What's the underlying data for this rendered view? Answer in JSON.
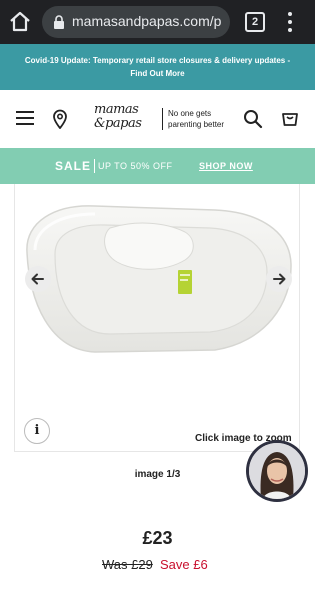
{
  "browser": {
    "url": "mamasandpapas.com/p",
    "tab_count": "2"
  },
  "banner": {
    "text": "Covid-19 Update: Temporary retail store closures & delivery updates - Find Out More"
  },
  "header": {
    "logo_line1": "mamas",
    "logo_line2": "&papas",
    "tagline_line1": "No one gets",
    "tagline_line2": "parenting better"
  },
  "sale": {
    "label": "SALE",
    "subtext": "UP TO 50% OFF",
    "cta": "SHOP NOW"
  },
  "gallery": {
    "zoom_hint": "Click image to zoom",
    "counter": "image 1/3"
  },
  "product": {
    "price": "£23",
    "was_price": "Was £29",
    "save": "Save £6"
  },
  "colors": {
    "banner": "#3b9aa3",
    "sale_bar": "#82cdb2",
    "save_text": "#c8102e"
  }
}
